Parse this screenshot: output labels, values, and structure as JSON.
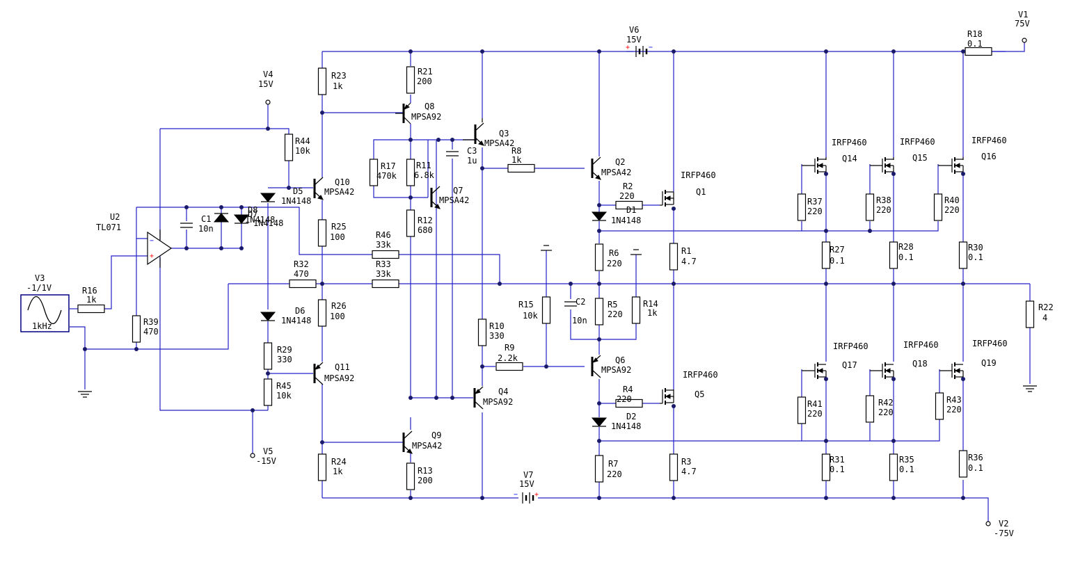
{
  "colors": {
    "wire": "#2020c8",
    "component": "#000000",
    "node": "#1a1a6a",
    "plus": "#ff0000",
    "minus": "#0000ff",
    "background": "#ffffff"
  },
  "icons": {
    "ground": "ground-icon",
    "terminal": "terminal-icon",
    "resistor": "resistor-icon",
    "diode": "diode-icon",
    "capacitor": "capacitor-icon",
    "battery": "battery-icon",
    "bjt": "bjt-icon",
    "mosfet": "mosfet-icon",
    "opamp": "opamp-icon",
    "sine": "sine-source-icon"
  },
  "sources": {
    "v1": {
      "ref": "V1",
      "value": "75V"
    },
    "v2": {
      "ref": "V2",
      "value": "-75V"
    },
    "v3": {
      "ref": "V3",
      "value": "-1/1V",
      "freq": "1kHz"
    },
    "v4": {
      "ref": "V4",
      "value": "15V"
    },
    "v5": {
      "ref": "V5",
      "value": "-15V"
    },
    "v6": {
      "ref": "V6",
      "value": "15V"
    },
    "v7": {
      "ref": "V7",
      "value": "15V"
    }
  },
  "opamp": {
    "ref": "U2",
    "value": "TL071"
  },
  "resistors": {
    "r1": {
      "ref": "R1",
      "value": "4.7"
    },
    "r2": {
      "ref": "R2",
      "value": "220"
    },
    "r3": {
      "ref": "R3",
      "value": "4.7"
    },
    "r4": {
      "ref": "R4",
      "value": "220"
    },
    "r5": {
      "ref": "R5",
      "value": "220"
    },
    "r6": {
      "ref": "R6",
      "value": "220"
    },
    "r7": {
      "ref": "R7",
      "value": "220"
    },
    "r8": {
      "ref": "R8",
      "value": "1k"
    },
    "r9": {
      "ref": "R9",
      "value": "2.2k"
    },
    "r10": {
      "ref": "R10",
      "value": "330"
    },
    "r11": {
      "ref": "R11",
      "value": "6.8k"
    },
    "r12": {
      "ref": "R12",
      "value": "680"
    },
    "r13": {
      "ref": "R13",
      "value": "200"
    },
    "r14": {
      "ref": "R14",
      "value": "1k"
    },
    "r15": {
      "ref": "R15",
      "value": "10k"
    },
    "r16": {
      "ref": "R16",
      "value": "1k"
    },
    "r17": {
      "ref": "R17",
      "value": "470k"
    },
    "r18": {
      "ref": "R18",
      "value": "0.1"
    },
    "r21": {
      "ref": "R21",
      "value": "200"
    },
    "r22": {
      "ref": "R22",
      "value": "4"
    },
    "r23": {
      "ref": "R23",
      "value": "1k"
    },
    "r24": {
      "ref": "R24",
      "value": "1k"
    },
    "r25": {
      "ref": "R25",
      "value": "100"
    },
    "r26": {
      "ref": "R26",
      "value": "100"
    },
    "r27": {
      "ref": "R27",
      "value": "0.1"
    },
    "r28": {
      "ref": "R28",
      "value": "0.1"
    },
    "r29": {
      "ref": "R29",
      "value": "330"
    },
    "r30": {
      "ref": "R30",
      "value": "0.1"
    },
    "r31": {
      "ref": "R31",
      "value": "0.1"
    },
    "r32": {
      "ref": "R32",
      "value": "470"
    },
    "r33": {
      "ref": "R33",
      "value": "33k"
    },
    "r35": {
      "ref": "R35",
      "value": "0.1"
    },
    "r36": {
      "ref": "R36",
      "value": "0.1"
    },
    "r37": {
      "ref": "R37",
      "value": "220"
    },
    "r38": {
      "ref": "R38",
      "value": "220"
    },
    "r39": {
      "ref": "R39",
      "value": "470"
    },
    "r40": {
      "ref": "R40",
      "value": "220"
    },
    "r41": {
      "ref": "R41",
      "value": "220"
    },
    "r42": {
      "ref": "R42",
      "value": "220"
    },
    "r43": {
      "ref": "R43",
      "value": "220"
    },
    "r44": {
      "ref": "R44",
      "value": "10k"
    },
    "r45": {
      "ref": "R45",
      "value": "10k"
    },
    "r46": {
      "ref": "R46",
      "value": "33k"
    }
  },
  "capacitors": {
    "c1": {
      "ref": "C1",
      "value": "10n"
    },
    "c2": {
      "ref": "C2",
      "value": "10n"
    },
    "c3": {
      "ref": "C3",
      "value": "1u"
    }
  },
  "diodes": {
    "d1": {
      "ref": "D1",
      "value": "1N4148"
    },
    "d2": {
      "ref": "D2",
      "value": "1N4148"
    },
    "d5": {
      "ref": "D5",
      "value": "1N4148"
    },
    "d6": {
      "ref": "D6",
      "value": "1N4148"
    },
    "d7": {
      "ref": "D7",
      "value": "1N4148"
    },
    "d8": {
      "ref": "D8",
      "value": "1N4148"
    }
  },
  "transistors": {
    "q2": {
      "ref": "Q2",
      "value": "MPSA42"
    },
    "q3": {
      "ref": "Q3",
      "value": "MPSA42"
    },
    "q4": {
      "ref": "Q4",
      "value": "MPSA92"
    },
    "q6": {
      "ref": "Q6",
      "value": "MPSA92"
    },
    "q7": {
      "ref": "Q7",
      "value": "MPSA42"
    },
    "q8": {
      "ref": "Q8",
      "value": "MPSA92"
    },
    "q9": {
      "ref": "Q9",
      "value": "MPSA42"
    },
    "q10": {
      "ref": "Q10",
      "value": "MPSA42"
    },
    "q11": {
      "ref": "Q11",
      "value": "MPSA92"
    }
  },
  "mosfets": {
    "q1": {
      "ref": "Q1",
      "value": "IRFP460"
    },
    "q5": {
      "ref": "Q5",
      "value": "IRFP460"
    },
    "q14": {
      "ref": "Q14",
      "value": "IRFP460"
    },
    "q15": {
      "ref": "Q15",
      "value": "IRFP460"
    },
    "q16": {
      "ref": "Q16",
      "value": "IRFP460"
    },
    "q17": {
      "ref": "Q17",
      "value": "IRFP460"
    },
    "q18": {
      "ref": "Q18",
      "value": "IRFP460"
    },
    "q19": {
      "ref": "Q19",
      "value": "IRFP460"
    }
  }
}
